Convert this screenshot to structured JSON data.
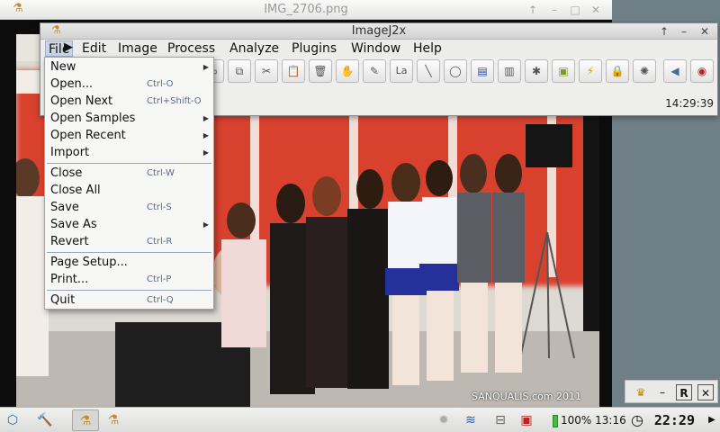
{
  "image_window": {
    "title": "IMG_2706.png",
    "watermark": "SANQUALIS.com 2011"
  },
  "imagej": {
    "title": "ImageJ2x",
    "menubar": [
      "File",
      "Edit",
      "Image",
      "Process",
      "Analyze",
      "Plugins",
      "Window",
      "Help"
    ],
    "status_time": "14:29:39",
    "toolbar_icons": [
      "rectangle-icon",
      "copy-icon",
      "paste-icon",
      "cut-icon",
      "clipboard-icon",
      "delete-icon",
      "hand-icon",
      "pencil-icon",
      "text-tool-icon",
      "line-icon",
      "circle-icon",
      "new-doc-icon",
      "text-doc-icon",
      "puzzle-icon",
      "folder-icon",
      "macro-icon",
      "lock-icon",
      "settings-icon",
      "arrow-left-icon",
      "color-picker-icon"
    ]
  },
  "file_menu": {
    "items": [
      {
        "label": "New",
        "shortcut": "",
        "submenu": true
      },
      {
        "label": "Open...",
        "shortcut": "Ctrl-O",
        "submenu": false
      },
      {
        "label": "Open Next",
        "shortcut": "Ctrl+Shift-O",
        "submenu": false
      },
      {
        "label": "Open Samples",
        "shortcut": "",
        "submenu": true
      },
      {
        "label": "Open Recent",
        "shortcut": "",
        "submenu": true
      },
      {
        "label": "Import",
        "shortcut": "",
        "submenu": true
      },
      {
        "label": "Close",
        "shortcut": "Ctrl-W",
        "submenu": false
      },
      {
        "label": "Close All",
        "shortcut": "",
        "submenu": false
      },
      {
        "label": "Save",
        "shortcut": "Ctrl-S",
        "submenu": false
      },
      {
        "label": "Save As",
        "shortcut": "",
        "submenu": true
      },
      {
        "label": "Revert",
        "shortcut": "Ctrl-R",
        "submenu": false
      },
      {
        "label": "Page Setup...",
        "shortcut": "",
        "submenu": false
      },
      {
        "label": "Print...",
        "shortcut": "Ctrl-P",
        "submenu": false
      },
      {
        "label": "Quit",
        "shortcut": "Ctrl-Q",
        "submenu": false
      }
    ]
  },
  "taskbar": {
    "battery": "100%",
    "battery_time": "13:16",
    "clock": "22:29"
  },
  "colors": {
    "menu_highlight": "#cbd5e3",
    "photo_banner": "#d9412f"
  }
}
